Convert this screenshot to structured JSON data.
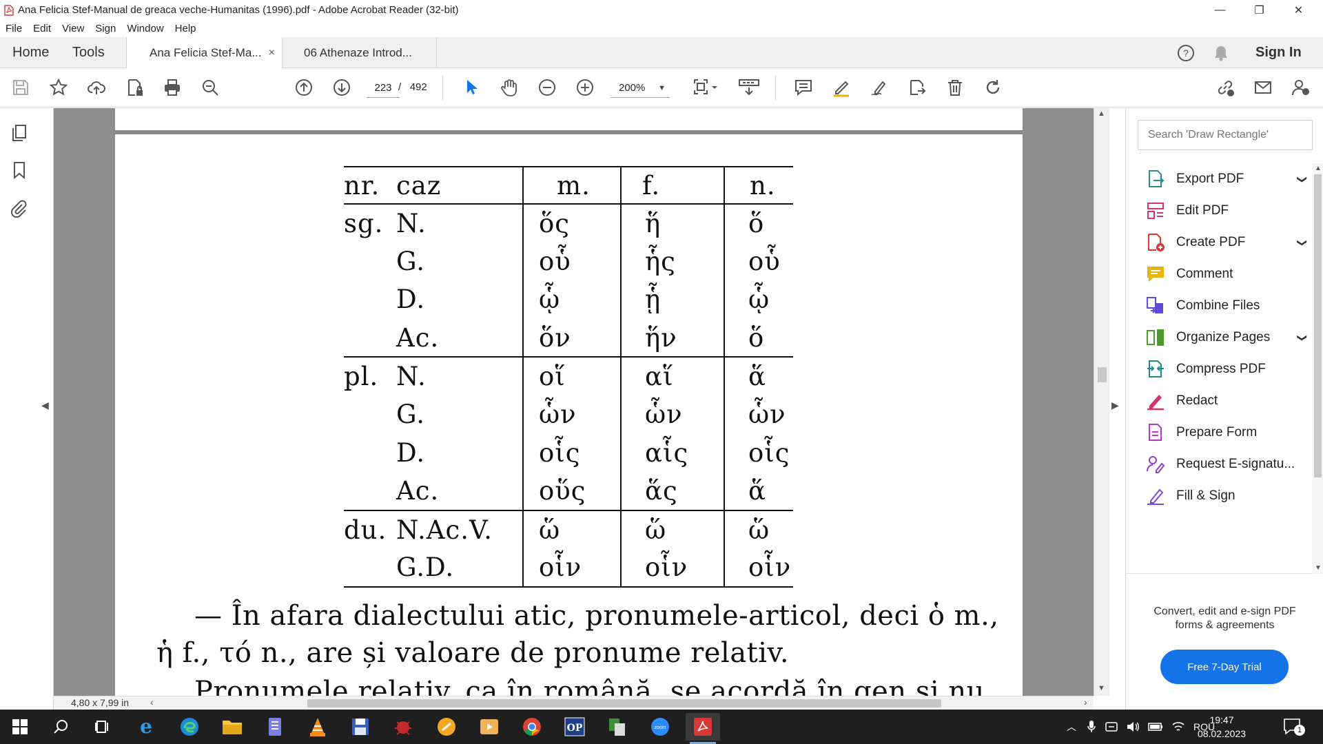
{
  "window": {
    "title": "Ana Felicia Stef-Manual de greaca veche-Humanitas (1996).pdf - Adobe Acrobat Reader (32-bit)",
    "minimize": "—",
    "restore": "❐",
    "close": "✕"
  },
  "menu": [
    "File",
    "Edit",
    "View",
    "Sign",
    "Window",
    "Help"
  ],
  "tabs": {
    "home": "Home",
    "tools": "Tools",
    "doc1": "Ana Felicia Stef-Ma...",
    "doc1_close": "×",
    "doc2": "06 Athenaze Introd...",
    "sign_in": "Sign In"
  },
  "toolbar": {
    "page_current": "223",
    "page_sep": "/",
    "page_total": "492",
    "zoom": "200%"
  },
  "document": {
    "table": {
      "headers": [
        "nr.",
        "caz",
        "m.",
        "f.",
        "n."
      ],
      "rows": [
        {
          "nr": "sg.",
          "caz": "N.",
          "m": "ὅς",
          "f": "ἥ",
          "n": "ὅ"
        },
        {
          "nr": "",
          "caz": "G.",
          "m": "οὗ",
          "f": "ἧς",
          "n": "οὗ"
        },
        {
          "nr": "",
          "caz": "D.",
          "m": "ᾧ",
          "f": "ᾗ",
          "n": "ᾧ"
        },
        {
          "nr": "",
          "caz": "Ac.",
          "m": "ὅν",
          "f": "ἥν",
          "n": "ὅ"
        },
        {
          "nr": "pl.",
          "caz": "N.",
          "m": "οἵ",
          "f": "αἵ",
          "n": "ἅ"
        },
        {
          "nr": "",
          "caz": "G.",
          "m": "ὧν",
          "f": "ὧν",
          "n": "ὧν"
        },
        {
          "nr": "",
          "caz": "D.",
          "m": "οἷς",
          "f": "αἷς",
          "n": "οἷς"
        },
        {
          "nr": "",
          "caz": "Ac.",
          "m": "οὕς",
          "f": "ἅς",
          "n": "ἅ"
        },
        {
          "nr": "du.",
          "caz": "N.Ac.V.",
          "m": "ὥ",
          "f": "ὥ",
          "n": "ὥ"
        },
        {
          "nr": "",
          "caz": "G.D.",
          "m": "οἷν",
          "f": "οἷν",
          "n": "οἷν"
        }
      ]
    },
    "para_line1": "— În afara dialectului atic, pronumele-articol, deci ὁ m.,",
    "para_line2": "ἡ f., τό n., are și valoare de pronume relativ.",
    "para_line3": "Pronumele relativ, ca în română, se acordă în gen și nu"
  },
  "status": {
    "page_size": "4,80 x 7,99 in"
  },
  "right_panel": {
    "search_placeholder": "Search 'Draw Rectangle'",
    "tools": [
      {
        "label": "Export PDF",
        "icon": "export-pdf-icon",
        "color": "#2d8a8a",
        "chevron": true
      },
      {
        "label": "Edit PDF",
        "icon": "edit-pdf-icon",
        "color": "#d6336c",
        "chevron": false
      },
      {
        "label": "Create PDF",
        "icon": "create-pdf-icon",
        "color": "#d93838",
        "chevron": true
      },
      {
        "label": "Comment",
        "icon": "comment-icon",
        "color": "#e8b30c",
        "chevron": false
      },
      {
        "label": "Combine Files",
        "icon": "combine-files-icon",
        "color": "#5b4bd6",
        "chevron": false
      },
      {
        "label": "Organize Pages",
        "icon": "organize-pages-icon",
        "color": "#4c9a2a",
        "chevron": true
      },
      {
        "label": "Compress PDF",
        "icon": "compress-pdf-icon",
        "color": "#1a8c8c",
        "chevron": false
      },
      {
        "label": "Redact",
        "icon": "redact-icon",
        "color": "#d6336c",
        "chevron": false
      },
      {
        "label": "Prepare Form",
        "icon": "prepare-form-icon",
        "color": "#b536c9",
        "chevron": false
      },
      {
        "label": "Request E-signatu...",
        "icon": "request-esign-icon",
        "color": "#8e3fc9",
        "chevron": false
      },
      {
        "label": "Fill & Sign",
        "icon": "fill-sign-icon",
        "color": "#7b4bd6",
        "chevron": false
      }
    ],
    "promo_line1": "Convert, edit and e-sign PDF",
    "promo_line2": "forms & agreements",
    "trial_button": "Free 7-Day Trial"
  },
  "taskbar": {
    "language": "ROU",
    "time": "19:47",
    "date": "08.02.2023",
    "notification_count": "1"
  }
}
